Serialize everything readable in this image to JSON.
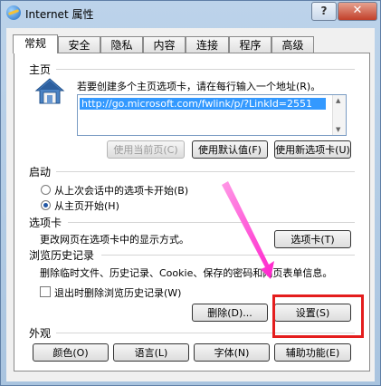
{
  "window": {
    "title": "Internet 属性",
    "help_glyph": "?",
    "close_glyph": "✕"
  },
  "tabs": [
    "常规",
    "安全",
    "隐私",
    "内容",
    "连接",
    "程序",
    "高级"
  ],
  "home": {
    "section": "主页",
    "instruction": "若要创建多个主页选项卡，请在每行输入一个地址(R)。",
    "url": "http://go.microsoft.com/fwlink/p/?LinkId=2551",
    "buttons": {
      "use_current": "使用当前页(C)",
      "use_default": "使用默认值(F)",
      "use_new_tab": "使用新选项卡(U)"
    }
  },
  "startup": {
    "section": "启动",
    "options": [
      "从上次会话中的选项卡开始(B)",
      "从主页开始(H)"
    ],
    "selected_index": 1
  },
  "tabs_section": {
    "section": "选项卡",
    "description": "更改网页在选项卡中的显示方式。",
    "button": "选项卡(T)"
  },
  "history": {
    "section": "浏览历史记录",
    "description": "删除临时文件、历史记录、Cookie、保存的密码和网页表单信息。",
    "checkbox_label": "退出时删除浏览历史记录(W)",
    "checked": false,
    "delete_button": "删除(D)...",
    "settings_button": "设置(S)"
  },
  "appearance": {
    "section": "外观",
    "buttons": [
      "颜色(O)",
      "语言(L)",
      "字体(N)",
      "辅助功能(E)"
    ]
  },
  "colors": {
    "annotation_red": "#e41d1d",
    "annotation_arrow": "#ff33cc",
    "selection": "#3399ff"
  }
}
